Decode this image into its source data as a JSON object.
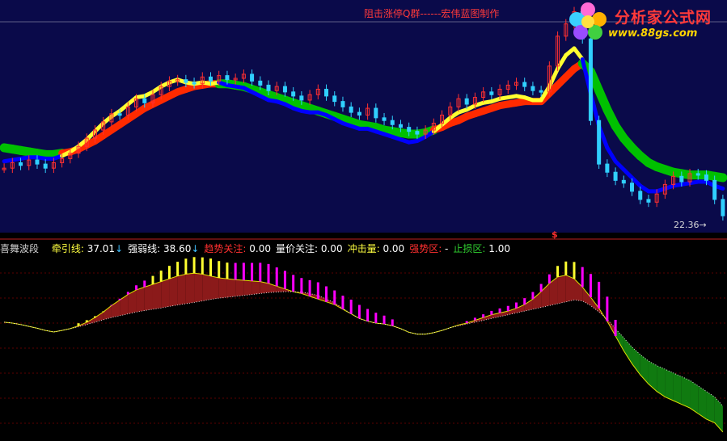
{
  "header": {
    "note": "阻击涨停Q群------宏伟蓝图制作",
    "logo_name": "分析家公式网",
    "logo_url": "www.88gs.com"
  },
  "price_label": "22.36→",
  "cursor_marker": "$",
  "legend": {
    "indicator_name": "喜舞波段",
    "items": [
      {
        "label": "牵引线:",
        "value": "37.01",
        "arrow": "↓",
        "color": "#ffff40"
      },
      {
        "label": "强弱线:",
        "value": "38.60",
        "arrow": "↓",
        "color": "#ffffff"
      },
      {
        "label": "趋势关注:",
        "value": "0.00",
        "arrow": "",
        "color": "#ff3030"
      },
      {
        "label": "量价关注:",
        "value": "0.00",
        "arrow": "",
        "color": "#ffffff"
      },
      {
        "label": "冲击量:",
        "value": "0.00",
        "arrow": "",
        "color": "#ffff40"
      },
      {
        "label": "强势区:",
        "value": "-",
        "arrow": "",
        "color": "#ff3030"
      },
      {
        "label": "止损区:",
        "value": "1.00",
        "arrow": "",
        "color": "#30d030"
      }
    ]
  },
  "colors": {
    "main_bg": "#0a0a4a",
    "sub_bg": "#000000",
    "candle_up": "#ff3030",
    "candle_down": "#30d0ff",
    "line_yellow": "#ffff30",
    "line_red": "#ff2a00",
    "line_blue": "#0000ff",
    "line_green": "#00c000",
    "fill_red": "#8b1a1a",
    "fill_green": "#107a10",
    "bar_yellow": "#ffff30",
    "bar_magenta": "#ff00ff"
  },
  "chart_data": {
    "type": "line",
    "title": "",
    "close": [
      36.5,
      36.9,
      36.7,
      37.1,
      36.8,
      36.5,
      36.9,
      37.2,
      37.6,
      38.1,
      38.7,
      39.3,
      39.9,
      40.5,
      40.4,
      41.0,
      41.6,
      41.3,
      41.9,
      42.5,
      42.9,
      43.0,
      42.8,
      42.7,
      43.2,
      42.9,
      43.3,
      43.0,
      43.1,
      43.4,
      42.9,
      42.6,
      42.2,
      42.5,
      42.1,
      41.8,
      41.5,
      41.9,
      42.3,
      41.8,
      41.4,
      41.0,
      40.6,
      40.4,
      40.9,
      40.2,
      40.0,
      39.7,
      39.5,
      39.2,
      39.0,
      39.3,
      39.8,
      40.4,
      41.0,
      41.6,
      41.2,
      41.7,
      42.1,
      41.9,
      42.3,
      42.6,
      42.8,
      42.5,
      42.2,
      42.1,
      44.0,
      46.2,
      47.1,
      48.0,
      46.0,
      40.0,
      36.8,
      36.2,
      35.6,
      35.4,
      34.8,
      34.2,
      34.0,
      34.6,
      35.3,
      35.9,
      35.5,
      36.1,
      36.0,
      35.6,
      34.2,
      33.0
    ],
    "traction_line": [
      37.0,
      37.1,
      37.2,
      37.3,
      37.3,
      37.2,
      37.2,
      37.4,
      37.7,
      38.1,
      38.6,
      39.2,
      39.8,
      40.3,
      40.7,
      41.2,
      41.7,
      41.8,
      42.1,
      42.5,
      42.8,
      43.0,
      42.8,
      42.7,
      42.8,
      42.7,
      42.8,
      42.6,
      42.5,
      42.4,
      42.1,
      41.8,
      41.5,
      41.4,
      41.2,
      40.9,
      40.7,
      40.6,
      40.6,
      40.4,
      40.1,
      39.8,
      39.6,
      39.4,
      39.4,
      39.2,
      39.0,
      38.8,
      38.6,
      38.4,
      38.5,
      38.8,
      39.2,
      39.7,
      40.2,
      40.6,
      40.8,
      41.1,
      41.3,
      41.4,
      41.6,
      41.7,
      41.8,
      41.7,
      41.5,
      41.5,
      42.5,
      43.8,
      44.8,
      45.3,
      44.5,
      42.0,
      39.6,
      38.0,
      37.0,
      36.4,
      35.8,
      35.2,
      34.8,
      34.8,
      35.0,
      35.2,
      35.3,
      35.4,
      35.5,
      35.5,
      35.2,
      35.0
    ],
    "strength_line": [
      38.0,
      37.9,
      37.8,
      37.7,
      37.6,
      37.5,
      37.5,
      37.6,
      37.7,
      37.9,
      38.2,
      38.5,
      38.9,
      39.3,
      39.7,
      40.1,
      40.5,
      40.9,
      41.2,
      41.5,
      41.8,
      42.1,
      42.3,
      42.5,
      42.6,
      42.7,
      42.7,
      42.7,
      42.6,
      42.5,
      42.3,
      42.1,
      41.9,
      41.7,
      41.5,
      41.3,
      41.1,
      40.9,
      40.7,
      40.5,
      40.3,
      40.1,
      39.9,
      39.7,
      39.6,
      39.5,
      39.3,
      39.2,
      39.1,
      39.0,
      39.0,
      39.1,
      39.3,
      39.5,
      39.8,
      40.0,
      40.3,
      40.5,
      40.7,
      40.9,
      41.1,
      41.2,
      41.3,
      41.4,
      41.4,
      41.4,
      42.0,
      42.6,
      43.2,
      43.8,
      44.2,
      43.6,
      42.2,
      40.8,
      39.6,
      38.7,
      38.0,
      37.4,
      36.9,
      36.6,
      36.4,
      36.2,
      36.1,
      36.0,
      36.0,
      36.0,
      35.9,
      35.8
    ],
    "ylim": [
      32,
      48.5
    ],
    "sub_indicator": {
      "name": "喜舞波段",
      "upper": [
        0.35,
        0.3,
        0.22,
        0.12,
        0.02,
        -0.1,
        -0.18,
        -0.1,
        0.0,
        0.15,
        0.35,
        0.6,
        0.9,
        1.25,
        1.55,
        1.85,
        2.1,
        2.25,
        2.4,
        2.55,
        2.7,
        2.85,
        2.95,
        3.0,
        2.95,
        2.85,
        2.75,
        2.7,
        2.65,
        2.62,
        2.58,
        2.55,
        2.45,
        2.3,
        2.15,
        2.0,
        1.9,
        1.75,
        1.6,
        1.45,
        1.3,
        1.05,
        0.8,
        0.55,
        0.4,
        0.3,
        0.25,
        0.15,
        0.0,
        -0.2,
        -0.3,
        -0.3,
        -0.22,
        -0.1,
        0.05,
        0.2,
        0.3,
        0.45,
        0.6,
        0.75,
        0.85,
        0.95,
        1.1,
        1.3,
        1.6,
        2.0,
        2.45,
        2.8,
        2.9,
        2.7,
        2.25,
        1.7,
        1.1,
        0.4,
        -0.4,
        -1.2,
        -1.9,
        -2.5,
        -3.0,
        -3.4,
        -3.7,
        -3.9,
        -4.1,
        -4.3,
        -4.6,
        -4.9,
        -5.1,
        -5.6
      ],
      "lower": [
        0.35,
        0.3,
        0.22,
        0.12,
        0.02,
        -0.1,
        -0.18,
        -0.1,
        0.0,
        0.1,
        0.22,
        0.35,
        0.48,
        0.6,
        0.7,
        0.8,
        0.9,
        0.98,
        1.05,
        1.12,
        1.2,
        1.28,
        1.35,
        1.42,
        1.5,
        1.58,
        1.65,
        1.7,
        1.75,
        1.8,
        1.85,
        1.9,
        1.95,
        1.98,
        2.0,
        2.0,
        1.98,
        1.9,
        1.8,
        1.6,
        1.4,
        1.1,
        0.8,
        0.55,
        0.4,
        0.3,
        0.25,
        0.15,
        0.0,
        -0.2,
        -0.3,
        -0.3,
        -0.22,
        -0.1,
        0.05,
        0.15,
        0.25,
        0.35,
        0.45,
        0.55,
        0.65,
        0.75,
        0.85,
        0.95,
        1.05,
        1.15,
        1.25,
        1.35,
        1.45,
        1.55,
        1.5,
        1.25,
        0.9,
        0.5,
        0.0,
        -0.5,
        -1.0,
        -1.4,
        -1.75,
        -2.0,
        -2.2,
        -2.4,
        -2.6,
        -2.8,
        -3.1,
        -3.4,
        -3.7,
        -4.2
      ],
      "bars": [
        0,
        0,
        0,
        0,
        0,
        0,
        0,
        0,
        0,
        -0.4,
        -0.3,
        -0.2,
        -0.1,
        0.1,
        0.2,
        0.4,
        0.7,
        1.0,
        1.3,
        1.7,
        2.0,
        2.2,
        2.4,
        2.5,
        2.6,
        2.7,
        2.6,
        2.5,
        2.6,
        2.7,
        2.8,
        2.9,
        3.0,
        2.9,
        2.8,
        2.6,
        2.4,
        2.5,
        2.6,
        2.4,
        2.2,
        2.1,
        2.2,
        2.1,
        1.9,
        1.6,
        1.3,
        1.0,
        0,
        0,
        0,
        0,
        0,
        0,
        0,
        0,
        0.3,
        0.4,
        0.5,
        0.6,
        0.7,
        0.8,
        0.9,
        1.0,
        1.1,
        1.2,
        1.4,
        1.7,
        2.1,
        2.6,
        3.1,
        3.6,
        4.1,
        3.8,
        2.5,
        0,
        0,
        0,
        0,
        0,
        0,
        0,
        0,
        0,
        0,
        0,
        0,
        0
      ],
      "bar_colors": [
        "m",
        "m",
        "m",
        "m",
        "m",
        "m",
        "m",
        "m",
        "m",
        "y",
        "y",
        "y",
        "y",
        "m",
        "m",
        "m",
        "m",
        "m",
        "y",
        "y",
        "y",
        "y",
        "y",
        "y",
        "y",
        "y",
        "y",
        "y",
        "m",
        "m",
        "m",
        "m",
        "m",
        "m",
        "m",
        "m",
        "m",
        "m",
        "m",
        "m",
        "m",
        "m",
        "m",
        "m",
        "m",
        "m",
        "m",
        "m",
        "m",
        "m",
        "m",
        "m",
        "m",
        "m",
        "m",
        "m",
        "m",
        "m",
        "m",
        "m",
        "m",
        "m",
        "m",
        "m",
        "m",
        "m",
        "m",
        "y",
        "y",
        "y",
        "m",
        "m",
        "m",
        "m",
        "m",
        "m",
        "m",
        "m",
        "m",
        "m",
        "m",
        "m",
        "m",
        "m",
        "m",
        "m",
        "m",
        "m"
      ],
      "ylim": [
        -6,
        3.8
      ]
    }
  }
}
